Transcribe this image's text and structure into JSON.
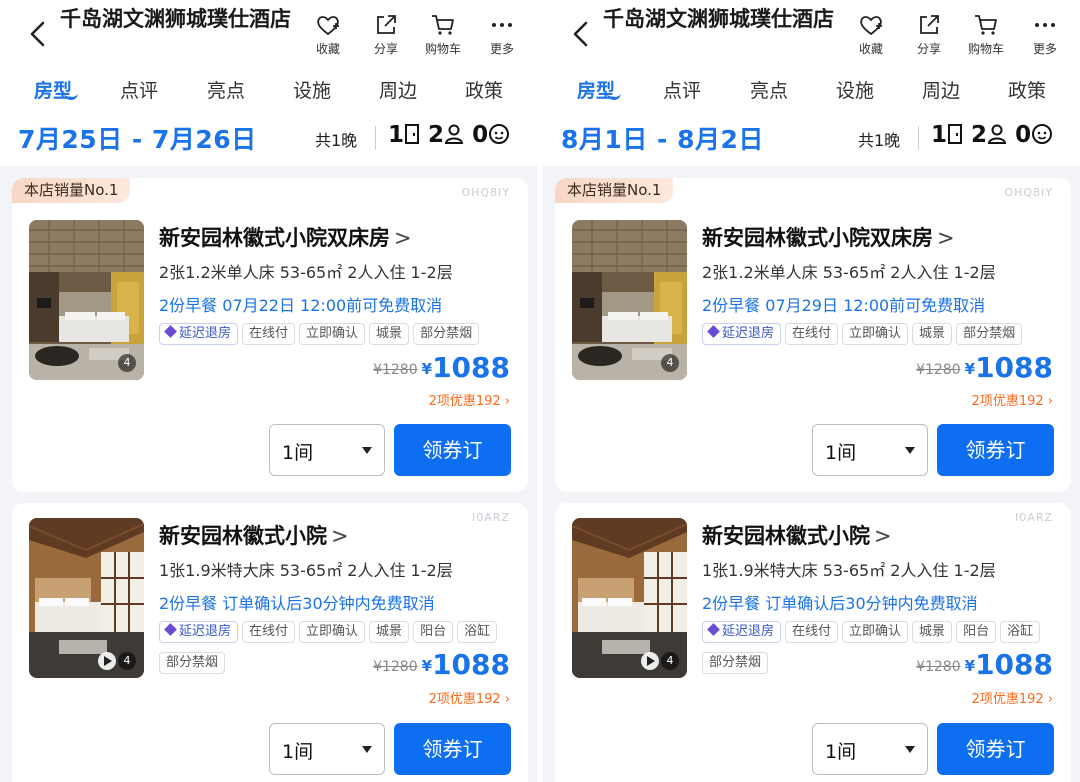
{
  "hotel_title": "千岛湖文渊狮城璞仕酒店",
  "actions": {
    "favorite": "收藏",
    "share": "分享",
    "cart": "购物车",
    "more": "更多"
  },
  "tabs": [
    "房型",
    "点评",
    "亮点",
    "设施",
    "周边",
    "政策"
  ],
  "summary": {
    "nights": "共1晚",
    "rooms": "1",
    "adults": "2",
    "children": "0"
  },
  "accent_color": "#1a73e8",
  "panels": [
    {
      "dates": "7月25日 - 7月26日",
      "rooms": [
        {
          "badge": "本店销量No.1",
          "code": "OHQ8IY",
          "name": "新安园林徽式小院双床房",
          "spec": "2张1.2米单人床  53-65㎡  2人入住  1-2层",
          "policy": "2份早餐   07月22日 12:00前可免费取消",
          "tags": [
            "延迟退房",
            "在线付",
            "立即确认",
            "城景",
            "部分禁烟"
          ],
          "photo_count": "4",
          "orig_price": "¥1280",
          "currency": "¥",
          "price": "1088",
          "promo": "2项优惠192 ›",
          "qty": "1间",
          "book": "领券订"
        },
        {
          "code": "I0ARZ",
          "name": "新安园林徽式小院",
          "spec": "1张1.9米特大床  53-65㎡  2人入住  1-2层",
          "policy": "2份早餐   订单确认后30分钟内免费取消",
          "tags": [
            "延迟退房",
            "在线付",
            "立即确认",
            "城景",
            "阳台",
            "浴缸",
            "部分禁烟"
          ],
          "photo_count": "4",
          "orig_price": "¥1280",
          "currency": "¥",
          "price": "1088",
          "promo": "2项优惠192 ›",
          "qty": "1间",
          "book": "领券订"
        }
      ]
    },
    {
      "dates": "8月1日 - 8月2日",
      "rooms": [
        {
          "badge": "本店销量No.1",
          "code": "OHQ8IY",
          "name": "新安园林徽式小院双床房",
          "spec": "2张1.2米单人床  53-65㎡  2人入住  1-2层",
          "policy": "2份早餐   07月29日 12:00前可免费取消",
          "tags": [
            "延迟退房",
            "在线付",
            "立即确认",
            "城景",
            "部分禁烟"
          ],
          "photo_count": "4",
          "orig_price": "¥1280",
          "currency": "¥",
          "price": "1088",
          "promo": "2项优惠192 ›",
          "qty": "1间",
          "book": "领券订"
        },
        {
          "code": "I0ARZ",
          "name": "新安园林徽式小院",
          "spec": "1张1.9米特大床  53-65㎡  2人入住  1-2层",
          "policy": "2份早餐   订单确认后30分钟内免费取消",
          "tags": [
            "延迟退房",
            "在线付",
            "立即确认",
            "城景",
            "阳台",
            "浴缸",
            "部分禁烟"
          ],
          "photo_count": "4",
          "orig_price": "¥1280",
          "currency": "¥",
          "price": "1088",
          "promo": "2项优惠192 ›",
          "qty": "1间",
          "book": "领券订"
        }
      ]
    }
  ]
}
